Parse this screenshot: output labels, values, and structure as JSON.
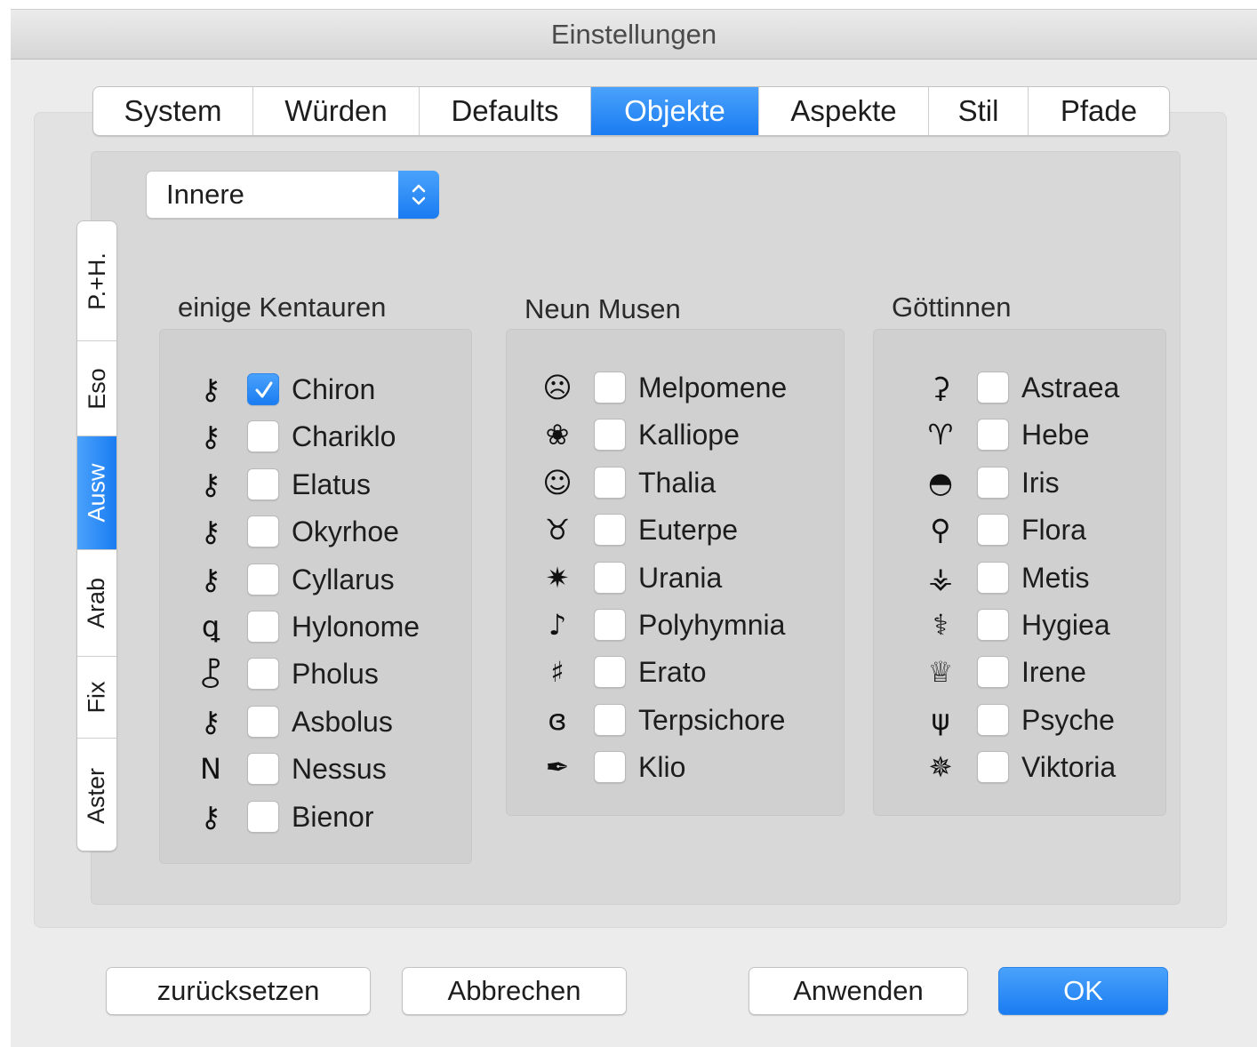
{
  "window": {
    "title": "Einstellungen"
  },
  "tabs": [
    {
      "label": "System",
      "active": false
    },
    {
      "label": "Würden",
      "active": false
    },
    {
      "label": "Defaults",
      "active": false
    },
    {
      "label": "Objekte",
      "active": true
    },
    {
      "label": "Aspekte",
      "active": false
    },
    {
      "label": "Stil",
      "active": false
    },
    {
      "label": "Pfade",
      "active": false
    }
  ],
  "popup": {
    "value": "Innere"
  },
  "side_tabs": [
    {
      "label": "P.+H.",
      "active": false
    },
    {
      "label": "Eso",
      "active": false
    },
    {
      "label": "Ausw",
      "active": true
    },
    {
      "label": "Arab",
      "active": false
    },
    {
      "label": "Fix",
      "active": false
    },
    {
      "label": "Aster",
      "active": false
    }
  ],
  "groups": [
    {
      "title": "einige Kentauren",
      "items": [
        {
          "symbol": "⚷",
          "label": "Chiron",
          "checked": true
        },
        {
          "symbol": "⚷",
          "label": "Chariklo",
          "checked": false
        },
        {
          "symbol": "⚷",
          "label": "Elatus",
          "checked": false
        },
        {
          "symbol": "⚷",
          "label": "Okyrhoe",
          "checked": false
        },
        {
          "symbol": "⚷",
          "label": "Cyllarus",
          "checked": false
        },
        {
          "symbol": "ꝗ",
          "label": "Hylonome",
          "checked": false
        },
        {
          "symbol": "⯛",
          "label": "Pholus",
          "checked": false
        },
        {
          "symbol": "⚷",
          "label": "Asbolus",
          "checked": false
        },
        {
          "symbol": "N",
          "label": "Nessus",
          "checked": false
        },
        {
          "symbol": "⚷",
          "label": "Bienor",
          "checked": false
        }
      ]
    },
    {
      "title": "Neun Musen",
      "items": [
        {
          "symbol": "☹",
          "label": "Melpomene",
          "checked": false
        },
        {
          "symbol": "❀",
          "label": "Kalliope",
          "checked": false
        },
        {
          "symbol": "☺",
          "label": "Thalia",
          "checked": false
        },
        {
          "symbol": "♉",
          "label": "Euterpe",
          "checked": false
        },
        {
          "symbol": "✷",
          "label": "Urania",
          "checked": false
        },
        {
          "symbol": "♪",
          "label": "Polyhymnia",
          "checked": false
        },
        {
          "symbol": "♯",
          "label": "Erato",
          "checked": false
        },
        {
          "symbol": "ɞ",
          "label": "Terpsichore",
          "checked": false
        },
        {
          "symbol": "✒",
          "label": "Klio",
          "checked": false
        }
      ]
    },
    {
      "title": "Göttinnen",
      "items": [
        {
          "symbol": "⚳",
          "label": "Astraea",
          "checked": false
        },
        {
          "symbol": "♈",
          "label": "Hebe",
          "checked": false
        },
        {
          "symbol": "◓",
          "label": "Iris",
          "checked": false
        },
        {
          "symbol": "⚲",
          "label": "Flora",
          "checked": false
        },
        {
          "symbol": "⚶",
          "label": "Metis",
          "checked": false
        },
        {
          "symbol": "⚕",
          "label": "Hygiea",
          "checked": false
        },
        {
          "symbol": "♕",
          "label": "Irene",
          "checked": false
        },
        {
          "symbol": "ψ",
          "label": "Psyche",
          "checked": false
        },
        {
          "symbol": "✵",
          "label": "Viktoria",
          "checked": false
        }
      ]
    }
  ],
  "buttons": {
    "reset": "zurücksetzen",
    "cancel": "Abbrechen",
    "apply": "Anwenden",
    "ok": "OK"
  },
  "colors": {
    "accent": "#1a7cf2"
  }
}
